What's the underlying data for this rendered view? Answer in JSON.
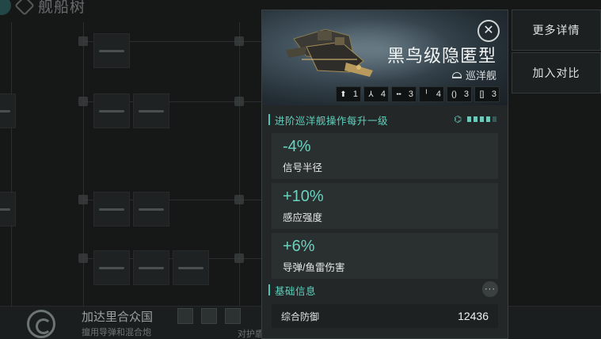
{
  "background": {
    "page_title": "舰船树",
    "faction": {
      "name": "加达里合众国",
      "subtitle": "擅用导弹和混合炮",
      "subtitle_tail": "对护盾的重视程度优于装甲"
    }
  },
  "side_buttons": {
    "details_label": "更多详情",
    "compare_label": "加入对比"
  },
  "panel": {
    "ship_name": "黑鸟级隐匿型",
    "ship_class": "巡洋舰",
    "close_icon": "close-icon",
    "slots": [
      {
        "icon": "turret-icon",
        "glyph": "⬆",
        "count": "1"
      },
      {
        "icon": "launcher-icon",
        "glyph": "⅄",
        "count": "4"
      },
      {
        "icon": "high-slot-icon",
        "glyph": "╍",
        "count": "3"
      },
      {
        "icon": "mid-slot-icon",
        "glyph": "╵",
        "count": "4"
      },
      {
        "icon": "low-slot-icon",
        "glyph": "()",
        "count": "3"
      },
      {
        "icon": "rig-slot-icon",
        "glyph": "[]",
        "count": "3"
      }
    ],
    "skill_section": {
      "title": "进阶巡洋舰操作每升一级",
      "skill_level": 4,
      "skill_max": 5
    },
    "bonuses": [
      {
        "value": "-4%",
        "label": "信号半径"
      },
      {
        "value": "+10%",
        "label": "感应强度"
      },
      {
        "value": "+6%",
        "label": "导弹/鱼雷伤害"
      }
    ],
    "basic_info": {
      "title": "基础信息",
      "more_label": "···",
      "rows": [
        {
          "label": "综合防御",
          "value": "12436"
        }
      ]
    }
  },
  "colors": {
    "accent": "#5ed3c0",
    "panel_bg": "#232727",
    "page_bg": "#141616"
  }
}
